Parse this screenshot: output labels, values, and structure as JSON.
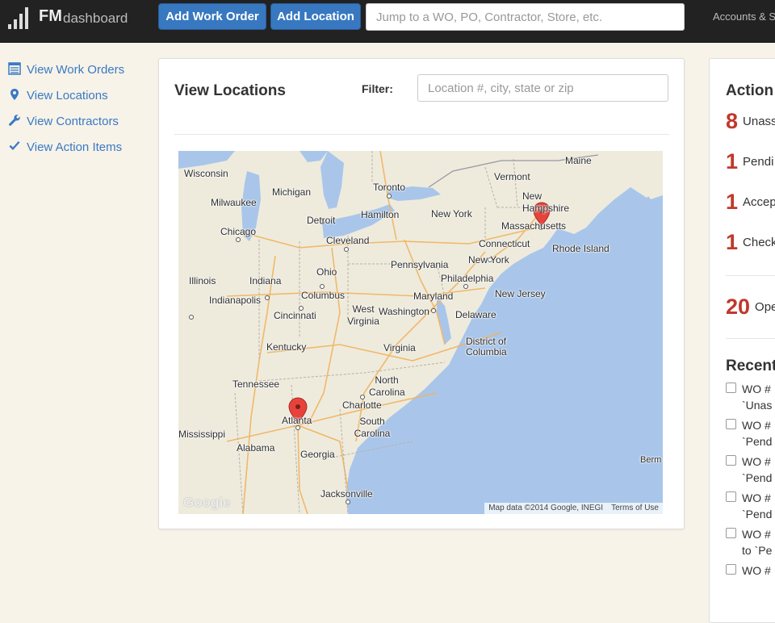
{
  "header": {
    "logo_bold": "FM",
    "logo_light": "dashboard",
    "add_work_order": "Add Work Order",
    "add_location": "Add Location",
    "jump_placeholder": "Jump to a WO, PO, Contractor, Store, etc.",
    "accounts": "Accounts & Se"
  },
  "sidebar": {
    "items": [
      {
        "label": "View Work Orders",
        "icon": "list-icon"
      },
      {
        "label": "View Locations",
        "icon": "map-pin-icon"
      },
      {
        "label": "View Contractors",
        "icon": "wrench-icon"
      },
      {
        "label": "View Action Items",
        "icon": "check-icon"
      }
    ]
  },
  "main": {
    "title": "View Locations",
    "filter_label": "Filter:",
    "filter_placeholder": "Location #, city, state or zip",
    "map": {
      "labels": [
        "Wisconsin",
        "Michigan",
        "Milwaukee",
        "Detroit",
        "Toronto",
        "Hamilton",
        "Chicago",
        "Cleveland",
        "Vermont",
        "Maine",
        "New Hampshire",
        "Massachusetts",
        "Rhode Island",
        "Connecticut",
        "New York",
        "New York",
        "Pennsylvania",
        "Philadelphia",
        "New Jersey",
        "Illinois",
        "Indiana",
        "Indianapolis",
        "Ohio",
        "Columbus",
        "Cincinnati",
        "West Virginia",
        "Washington",
        "Maryland",
        "Delaware",
        "District of Columbia",
        "Kentucky",
        "Virginia",
        "Tennessee",
        "North Carolina",
        "Charlotte",
        "South Carolina",
        "Atlanta",
        "Mississippi",
        "Alabama",
        "Georgia",
        "Jacksonville",
        "Berm"
      ],
      "attribution": "Map data ©2014 Google, INEGI",
      "terms": "Terms of Use",
      "google": "Google",
      "marker_color": "#e8433b"
    }
  },
  "action": {
    "title": "Action I",
    "stats": [
      {
        "count": "8",
        "label": "Unass"
      },
      {
        "count": "1",
        "label": "Pendi"
      },
      {
        "count": "1",
        "label": "Accep"
      },
      {
        "count": "1",
        "label": "Check"
      },
      {
        "count": "20",
        "label": "Ope"
      }
    ],
    "recent_title": "Recent",
    "recent": [
      {
        "line1": "WO #",
        "line2": "`Unas"
      },
      {
        "line1": "WO #",
        "line2": "`Pend"
      },
      {
        "line1": "WO #",
        "line2": "`Pend"
      },
      {
        "line1": "WO #",
        "line2": "`Pend"
      },
      {
        "line1": "WO #",
        "line2": "to `Pe"
      },
      {
        "line1": "WO #",
        "line2": ""
      }
    ],
    "count_color": "#c0392b"
  },
  "colors": {
    "accent": "#3a79c5",
    "button": "#3778c0",
    "topbar": "#222222",
    "background": "#f7f3e8",
    "water": "#a9c6ea",
    "land": "#eeebdd"
  }
}
